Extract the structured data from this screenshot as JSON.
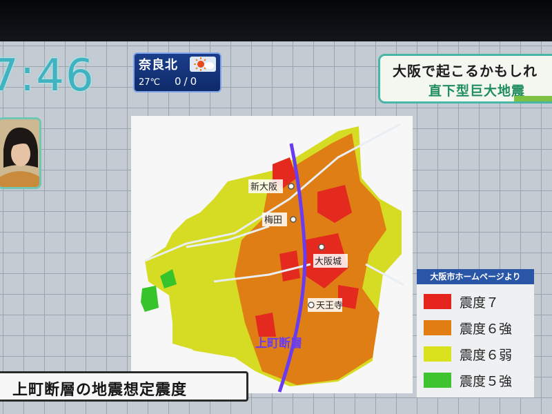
{
  "clock": {
    "time": "7:46"
  },
  "weather": {
    "city": "奈良北",
    "temperature": "27℃",
    "precipitation": "0/0",
    "icon": "sun-icon"
  },
  "headline": {
    "line1": "大阪で起こるかもしれ",
    "line2": "直下型巨大地震"
  },
  "map": {
    "places": [
      "新大阪",
      "梅田",
      "大阪城",
      "天王寺"
    ],
    "fault_label": "上町断層"
  },
  "legend": {
    "source": "大阪市ホームページより",
    "items": [
      {
        "label": "震度７",
        "color": "#e6241e"
      },
      {
        "label": "震度６強",
        "color": "#e27d12"
      },
      {
        "label": "震度６弱",
        "color": "#d9e21c"
      },
      {
        "label": "震度５強",
        "color": "#3ec42e"
      }
    ]
  },
  "caption": {
    "text": "上町断層の地震想定震度"
  },
  "colors": {
    "accent": "#3fb3c0",
    "fault_line": "#6a3cf0",
    "weather_bg": "#1a3e8c"
  }
}
